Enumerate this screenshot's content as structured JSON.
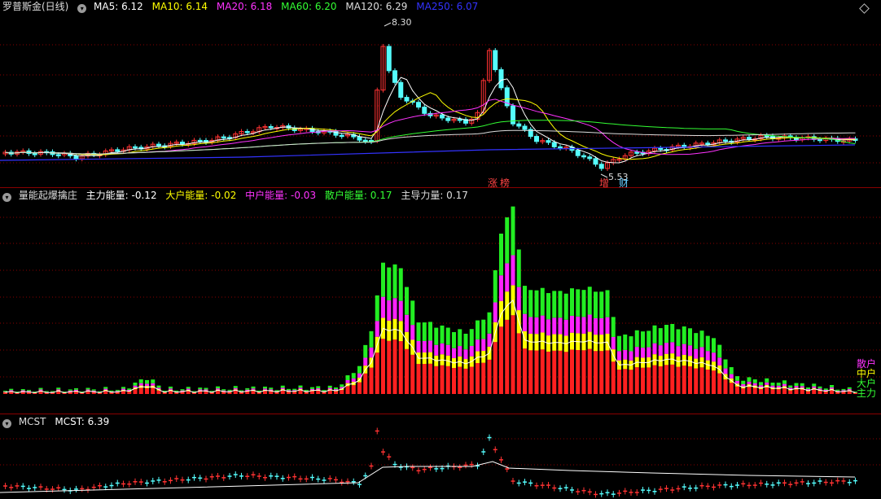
{
  "price_panel": {
    "title": "罗普斯金(日线)",
    "indicators": [
      {
        "label": "MA5: 6.12",
        "color": "#ffffff"
      },
      {
        "label": "MA10: 6.14",
        "color": "#ffff00"
      },
      {
        "label": "MA20: 6.18",
        "color": "#ff33ff"
      },
      {
        "label": "MA60: 6.20",
        "color": "#33ff33"
      },
      {
        "label": "MA120: 6.29",
        "color": "#dddddd"
      },
      {
        "label": "MA250: 6.07",
        "color": "#3333ff"
      }
    ],
    "high_label": "8.30",
    "low_label": "5.53",
    "tags": [
      {
        "text": "涨",
        "color": "#ff4444"
      },
      {
        "text": "榜",
        "color": "#ff4444"
      },
      {
        "text": "增",
        "color": "#ff4444"
      },
      {
        "text": "财",
        "color": "#66ccff"
      }
    ]
  },
  "energy_panel": {
    "title": "量能起爆擒庄",
    "indicators": [
      {
        "label": "主力能量: -0.12",
        "color": "#ffffff"
      },
      {
        "label": "大户能量: -0.02",
        "color": "#ffff00"
      },
      {
        "label": "中户能量: -0.03",
        "color": "#ff33ff"
      },
      {
        "label": "散户能量: 0.17",
        "color": "#33ff33"
      },
      {
        "label": "主导力量: 0.17",
        "color": "#dddddd"
      }
    ],
    "side_labels": [
      {
        "text": "散户",
        "color": "#ff33ff"
      },
      {
        "text": "中户",
        "color": "#ffff00"
      },
      {
        "text": "大户",
        "color": "#33ff33"
      },
      {
        "text": "主力",
        "color": "#33ff33"
      }
    ]
  },
  "mcst_panel": {
    "title": "MCST",
    "indicators": [
      {
        "label": "MCST: 6.39",
        "color": "#ffffff"
      }
    ]
  },
  "icons": [
    "circle-menu-icon",
    "diamond-icon"
  ],
  "colors": {
    "up": "#ff3232",
    "down": "#54fcfc",
    "background": "#000000",
    "grid": "#8a0000"
  }
}
